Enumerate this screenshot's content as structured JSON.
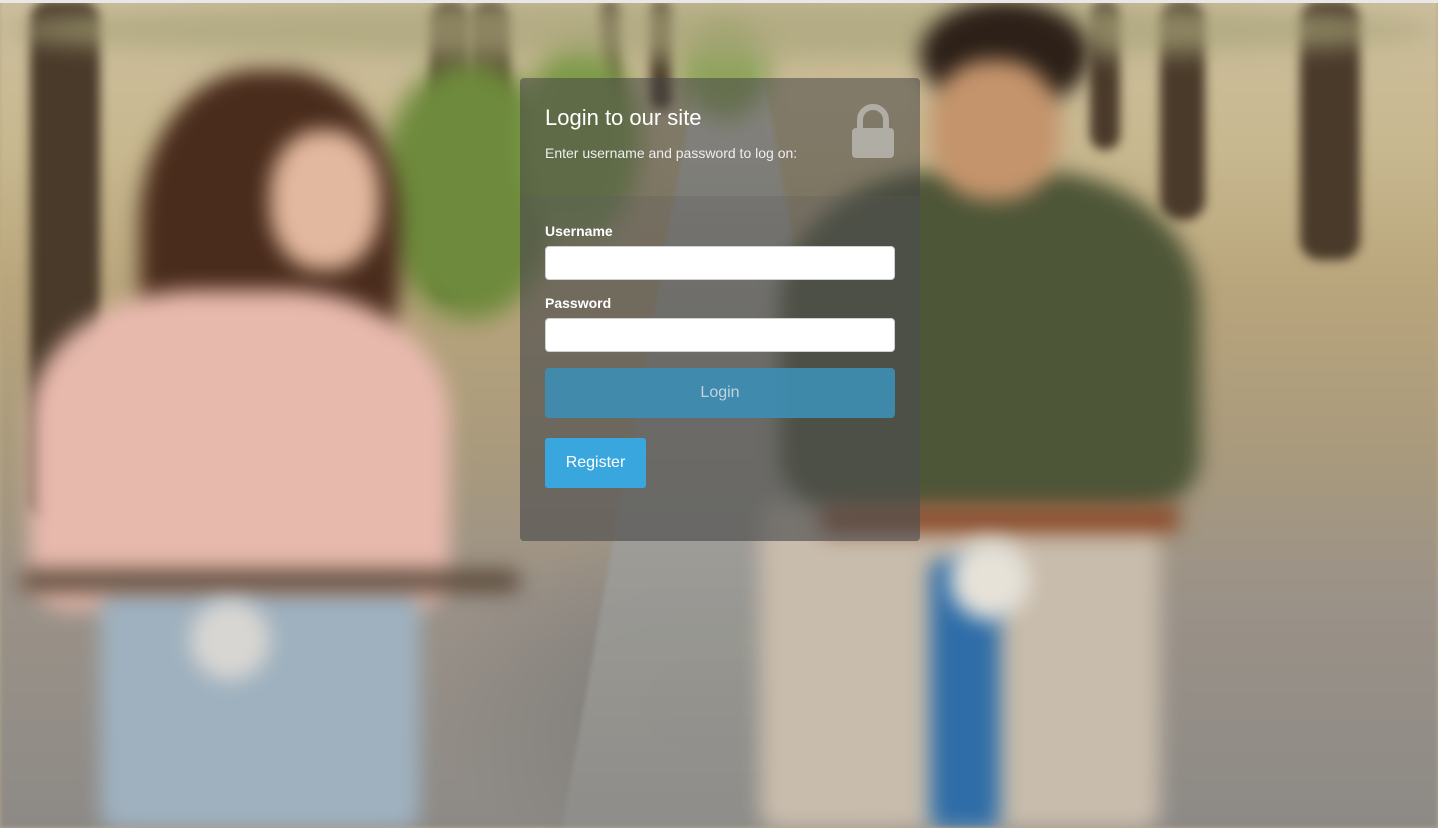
{
  "login": {
    "title": "Login to our site",
    "subtitle": "Enter username and password to log on:",
    "lock_icon": "lock-icon",
    "username_label": "Username",
    "username_value": "",
    "password_label": "Password",
    "password_value": "",
    "login_button": "Login",
    "register_button": "Register"
  },
  "colors": {
    "login_button": "#3d8db3",
    "register_button": "#3aa6de"
  }
}
